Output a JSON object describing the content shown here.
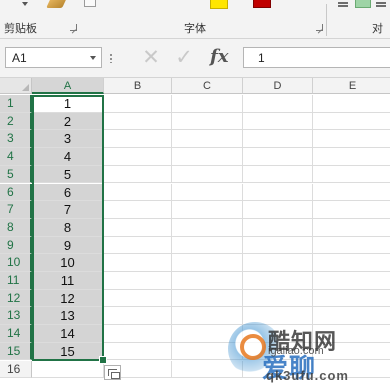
{
  "ribbon": {
    "clipboard_label": "剪贴板",
    "font_group_label": "字体",
    "align_group_label": "对"
  },
  "formula_bar": {
    "name_box_value": "A1",
    "formula_value": "1",
    "fx_label": "fx"
  },
  "columns": [
    "A",
    "B",
    "C",
    "D",
    "E"
  ],
  "rows": [
    "1",
    "2",
    "3",
    "4",
    "5",
    "6",
    "7",
    "8",
    "9",
    "10",
    "11",
    "12",
    "13",
    "14",
    "15",
    "16"
  ],
  "column_a_values": [
    "1",
    "2",
    "3",
    "4",
    "5",
    "6",
    "7",
    "8",
    "9",
    "10",
    "11",
    "12",
    "13",
    "14",
    "15"
  ],
  "colors": {
    "accent": "#217346",
    "selection_fill": "#d4d4d4",
    "ribbon_bg": "#f3f3f3"
  },
  "watermark": {
    "top_text": "酷知网",
    "middle_text": "爱聊",
    "url_small": "igaliao.com",
    "url_bottom": "qk3ufu.com"
  }
}
